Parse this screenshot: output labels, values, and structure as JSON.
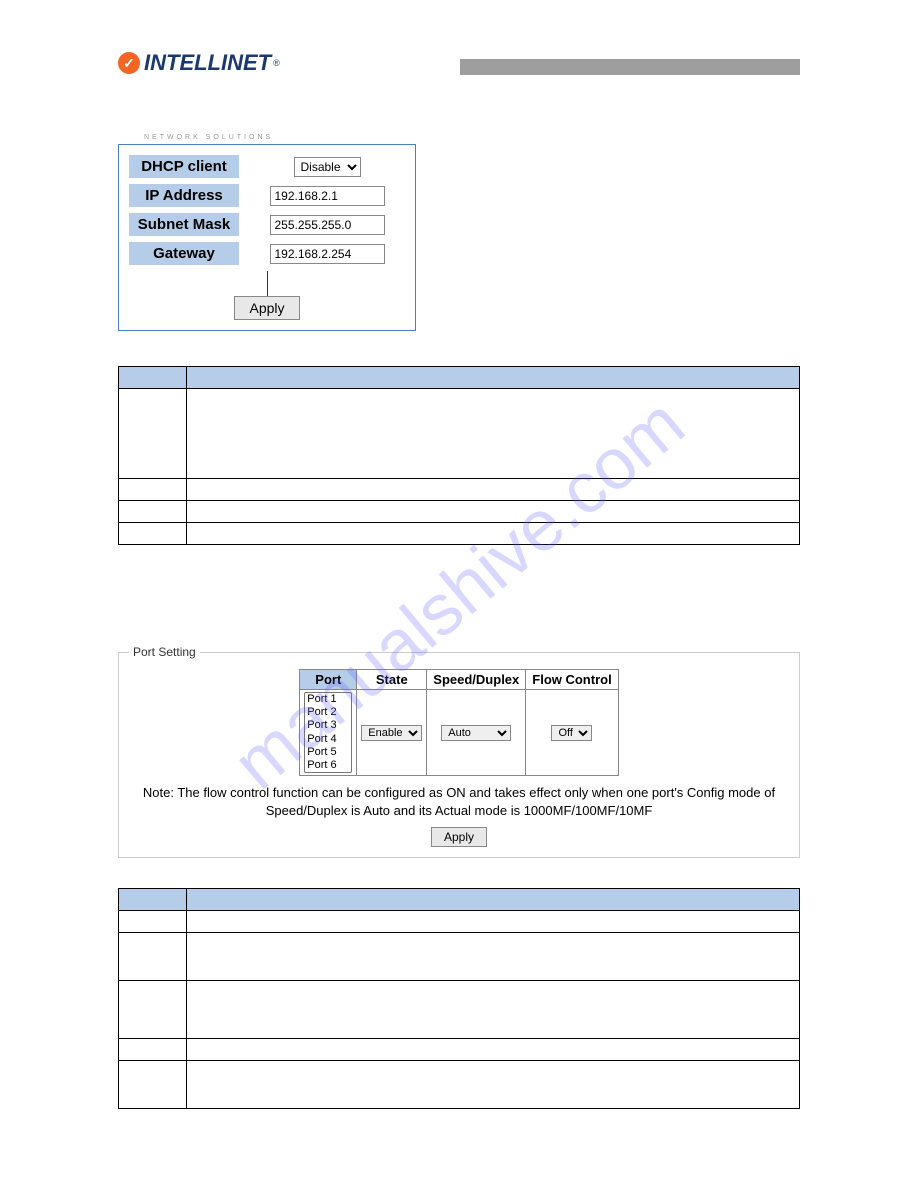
{
  "logo": {
    "brand": "INTELLINET",
    "tag": "NETWORK SOLUTIONS",
    "reg": "®"
  },
  "watermark": "manualshive.com",
  "ip_config": {
    "labels": {
      "dhcp": "DHCP client",
      "ip": "IP Address",
      "subnet": "Subnet Mask",
      "gateway": "Gateway"
    },
    "values": {
      "dhcp": "Disable",
      "ip": "192.168.2.1",
      "subnet": "255.255.255.0",
      "gateway": "192.168.2.254"
    },
    "apply": "Apply"
  },
  "port_setting": {
    "legend": "Port Setting",
    "headers": {
      "port": "Port",
      "state": "State",
      "speed": "Speed/Duplex",
      "flow": "Flow Control"
    },
    "ports": [
      "Port 1",
      "Port 2",
      "Port 3",
      "Port 4",
      "Port 5",
      "Port 6"
    ],
    "state_value": "Enable",
    "speed_value": "Auto",
    "flow_value": "Off",
    "note": "Note: The flow control function can be configured as ON and takes effect only when one port's Config mode of Speed/Duplex is Auto and its Actual mode is 1000MF/100MF/10MF",
    "apply": "Apply"
  }
}
